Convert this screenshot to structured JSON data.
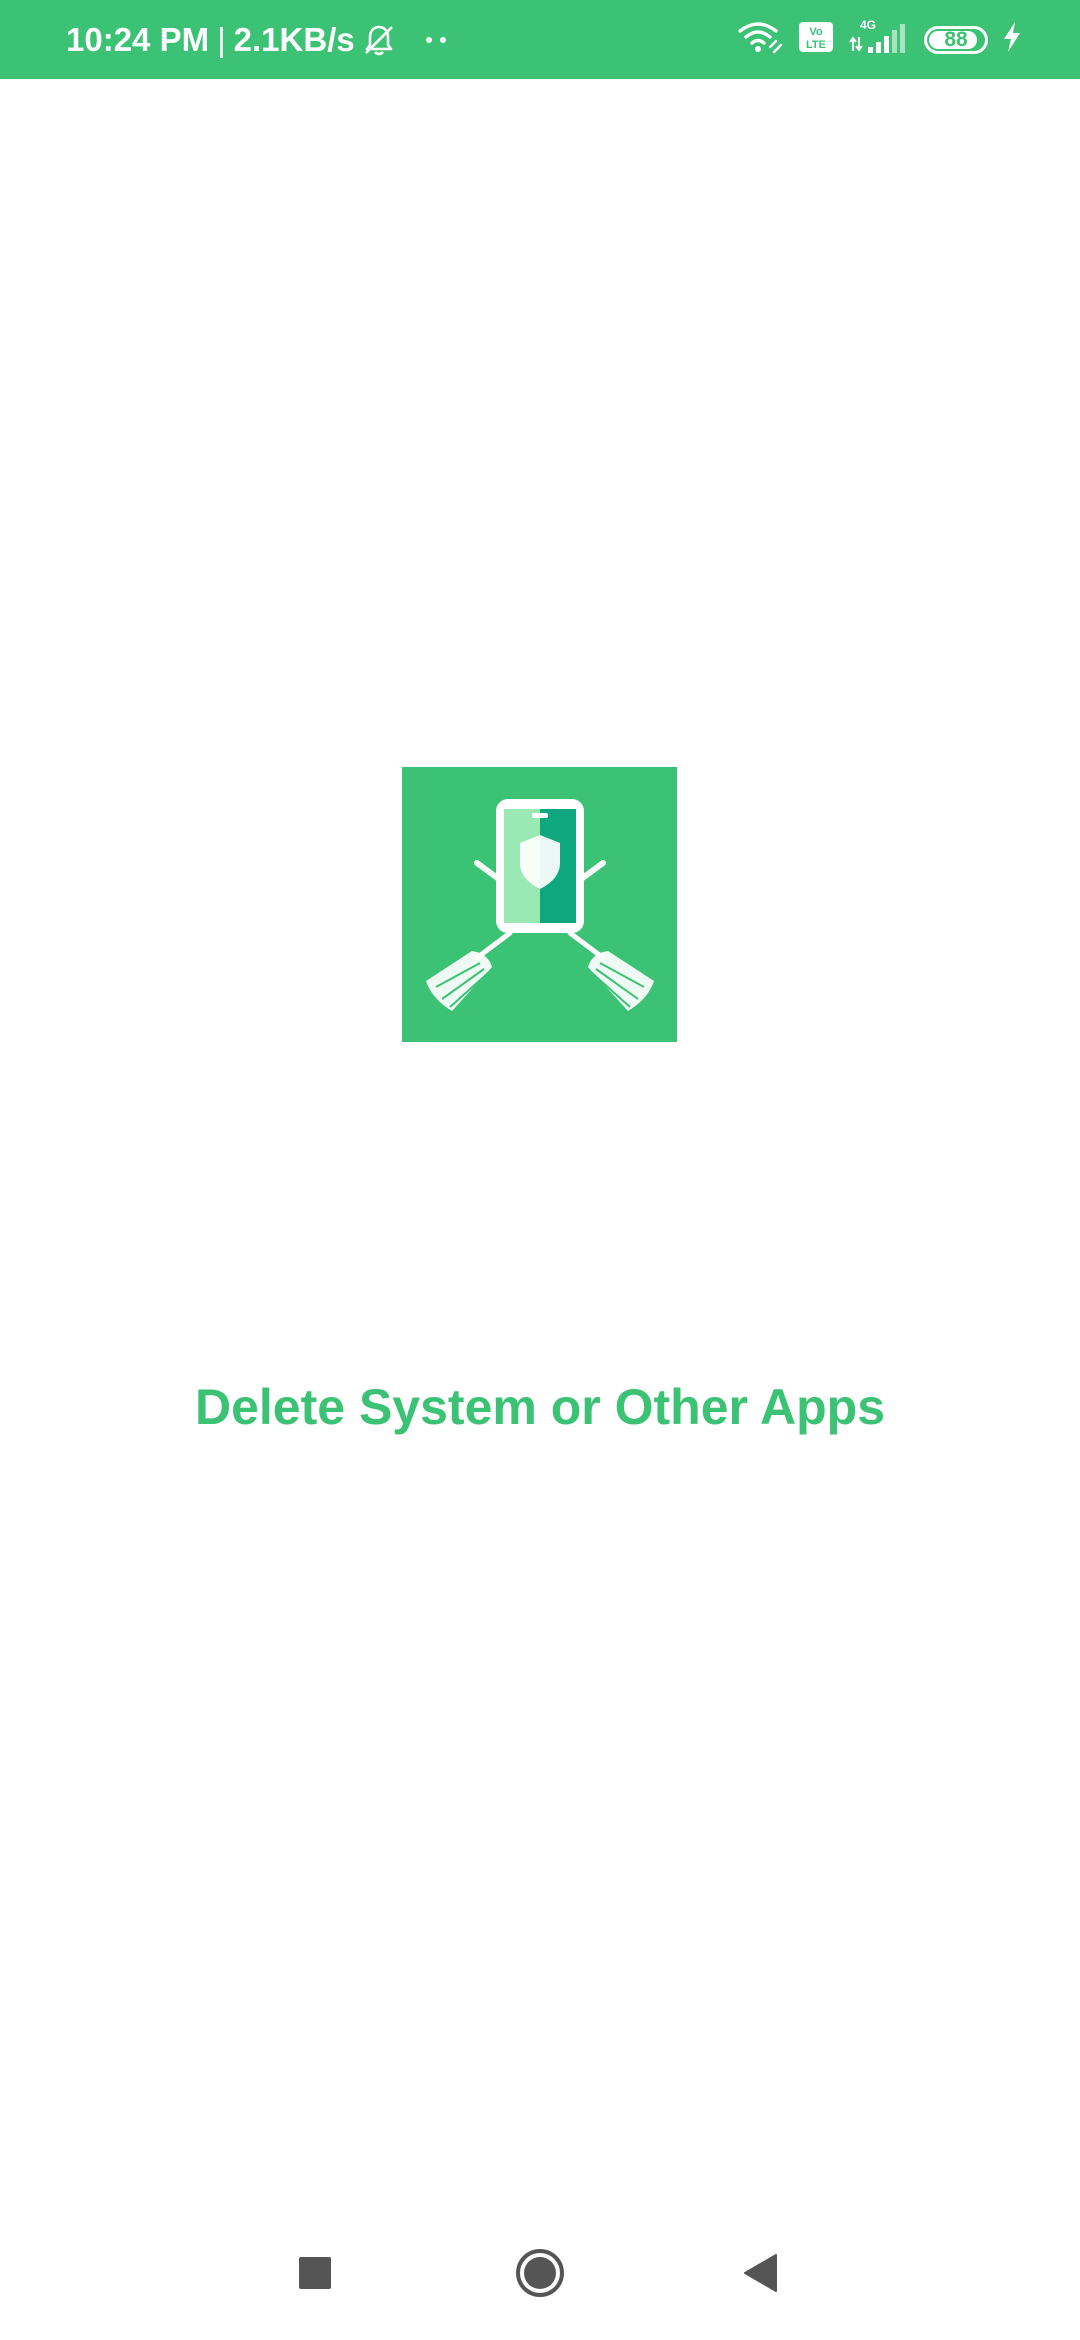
{
  "status_bar": {
    "time": "10:24 PM",
    "separator": "|",
    "network_speed": "2.1KB/s",
    "network_type": "4G",
    "volte_label": "Vo LTE",
    "battery_level": 88,
    "battery_text": "88",
    "icons": [
      "mute-bell-icon",
      "more-dots-icon",
      "wifi-icon",
      "volte-icon",
      "cellular-signal-icon",
      "battery-icon",
      "charging-bolt-icon"
    ]
  },
  "splash": {
    "logo_icon": "phone-cleaner-logo-icon",
    "title": "Delete System or Other Apps"
  },
  "navigation": {
    "icons": [
      "recents-square-icon",
      "home-circle-icon",
      "back-triangle-icon"
    ]
  },
  "colors": {
    "accent": "#3cc274",
    "accent_dark": "#0fa87e",
    "accent_light": "#9ae9b4",
    "background": "#ffffff",
    "nav_icon": "#555555"
  }
}
